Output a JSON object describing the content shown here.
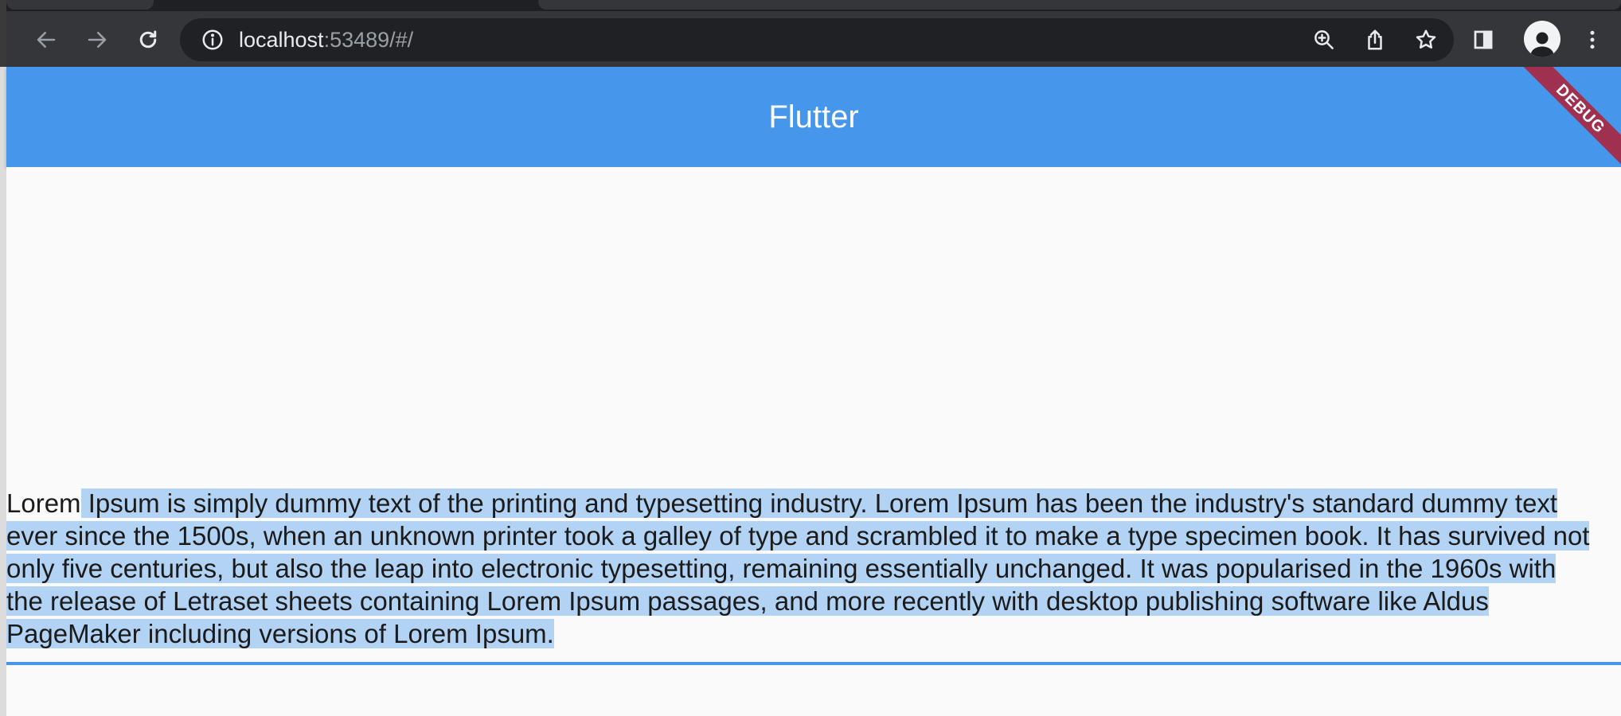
{
  "browser": {
    "url_host": "localhost",
    "url_rest": ":53489/#/",
    "icons": {
      "back": "back-arrow-icon",
      "forward": "forward-arrow-icon",
      "reload": "reload-icon",
      "info": "info-icon",
      "zoom": "zoom-in-icon",
      "share": "share-icon",
      "bookmark": "star-icon",
      "sidepanel": "side-panel-icon",
      "profile": "profile-avatar-icon",
      "menu": "kebab-menu-icon"
    }
  },
  "app": {
    "title": "Flutter",
    "debug_banner": "DEBUG",
    "colors": {
      "appbar": "#4696ec",
      "selection": "#b3d3f5",
      "underline": "#4b95e6",
      "debug": "#a03050"
    }
  },
  "content": {
    "text_unselected": "Lorem",
    "text_selected": " Ipsum is simply dummy text of the printing and typesetting industry. Lorem Ipsum has been the industry's standard dummy text ever since the 1500s, when an unknown printer took a galley of type and scrambled it to make a type specimen book. It has survived not only five centuries, but also the leap into electronic typesetting, remaining essentially unchanged. It was popularised in the 1960s with the release of Letraset sheets containing Lorem Ipsum passages, and more recently with desktop publishing software like Aldus PageMaker including versions of Lorem Ipsum."
  }
}
